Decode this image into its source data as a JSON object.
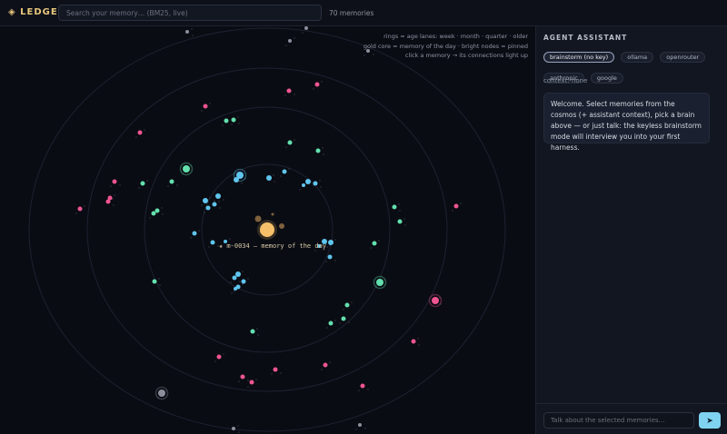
{
  "header": {
    "logo": "◈ LEDGER",
    "search_placeholder": "Search your memory… (BM25, live)",
    "memory_count": "70 memories"
  },
  "cosmos": {
    "legend": [
      "rings = age lanes: week · month · quarter · older",
      "gold core = memory of the day · bright nodes = pinned",
      "click a memory → its connections light up"
    ],
    "core_label": "★ m-0034 — memory of the day",
    "colors": {
      "core": "#f6c06a",
      "week": "#5fc5ee",
      "month": "#63e0ad",
      "quarter": "#ee5591",
      "older": "#8b8f9c"
    }
  },
  "assistant": {
    "title": "AGENT ASSISTANT",
    "providers": [
      {
        "label": "brainstorm (no key)",
        "active": true
      },
      {
        "label": "ollama",
        "active": false
      },
      {
        "label": "openrouter",
        "active": false
      },
      {
        "label": "anthropic",
        "active": false
      },
      {
        "label": "google",
        "active": false
      }
    ],
    "context": "context: none",
    "welcome": "Welcome. Select memories from the cosmos (+ assistant context), pick a brain above — or just talk: the keyless brainstorm mode will interview you into your first harness.",
    "input_placeholder": "Talk about the selected memories…",
    "send_icon": "➤"
  }
}
